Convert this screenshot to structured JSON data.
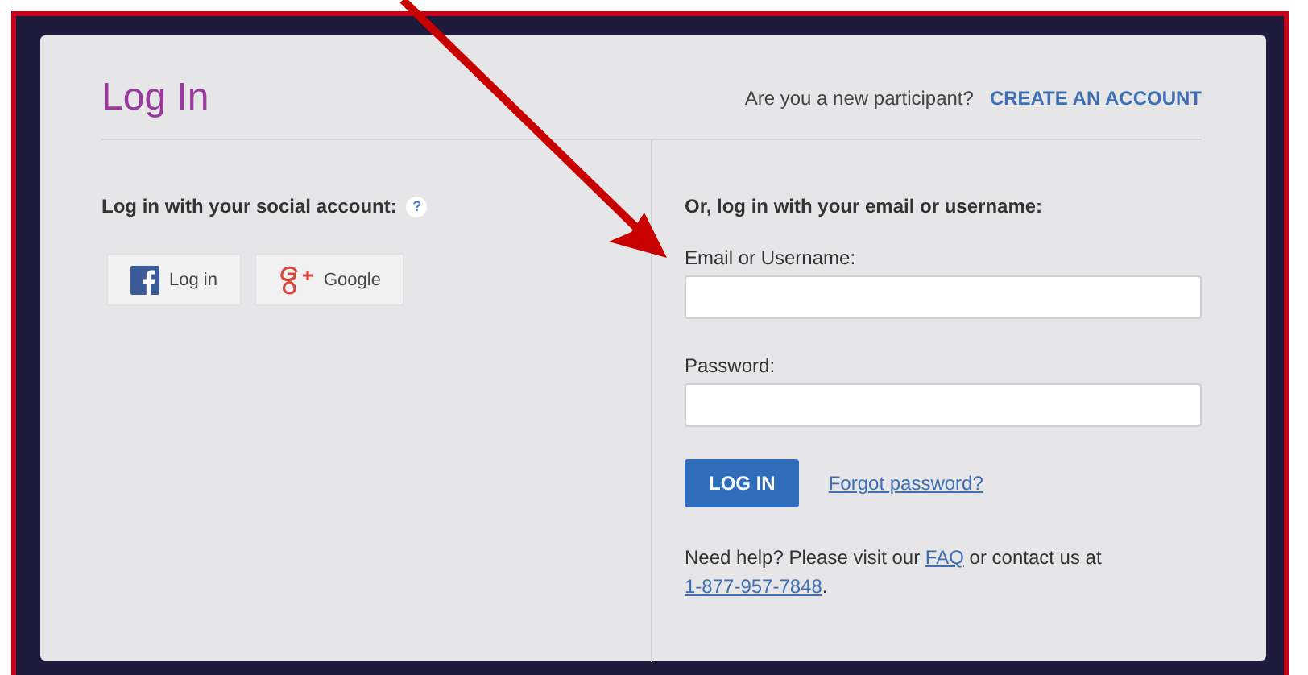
{
  "header": {
    "title": "Log In",
    "prompt": "Are you a new participant?",
    "create_link": "CREATE AN ACCOUNT"
  },
  "social": {
    "heading": "Log in with your social account:",
    "help_icon": "?",
    "buttons": [
      {
        "kind": "facebook",
        "label": "Log in"
      },
      {
        "kind": "google",
        "label": "Google"
      }
    ]
  },
  "form": {
    "heading": "Or, log in with your email or username:",
    "fields": [
      {
        "label": "Email or Username:"
      },
      {
        "label": "Password:"
      }
    ],
    "submit": "LOG IN",
    "forgot_link": "Forgot password?",
    "help": [
      {
        "kind": "text",
        "text": "Need help? Please visit our "
      },
      {
        "kind": "link",
        "text": "FAQ"
      },
      {
        "kind": "text",
        "text": " or contact us at "
      },
      {
        "kind": "link",
        "text": "1-877-957-7848"
      },
      {
        "kind": "text",
        "text": "."
      }
    ]
  }
}
